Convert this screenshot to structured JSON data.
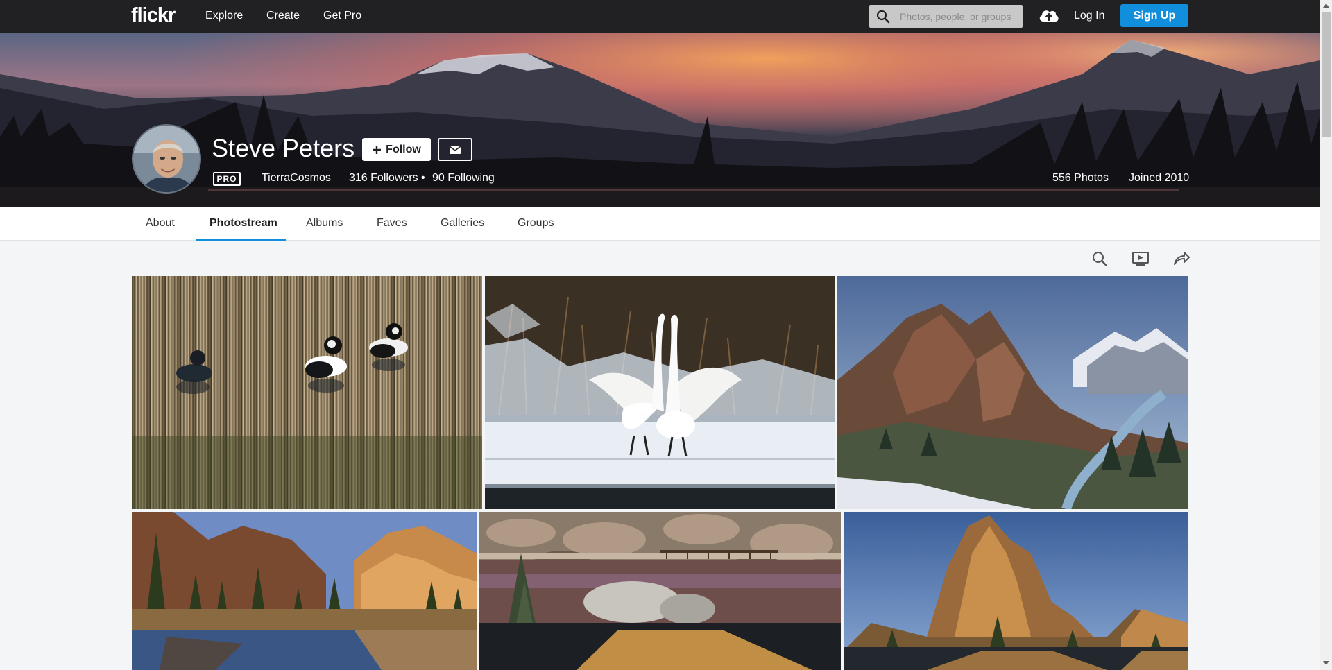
{
  "nav": {
    "logo": "flickr",
    "links": [
      "Explore",
      "Create",
      "Get Pro"
    ],
    "search_placeholder": "Photos, people, or groups",
    "login": "Log In",
    "signup": "Sign Up"
  },
  "profile": {
    "name": "Steve Peters",
    "follow_label": "Follow",
    "pro_badge": "PRO",
    "username": "TierraCosmos",
    "followers": "316 Followers",
    "separator": "•",
    "following": "90 Following",
    "photos": "556 Photos",
    "joined": "Joined 2010"
  },
  "tabs": [
    "About",
    "Photostream",
    "Albums",
    "Faves",
    "Galleries",
    "Groups"
  ],
  "active_tab": "Photostream",
  "colors": {
    "brand_blue": "#128fdc",
    "nav_bg": "#212124"
  },
  "toolbar_icons": [
    "search-icon",
    "slideshow-icon",
    "share-icon"
  ]
}
